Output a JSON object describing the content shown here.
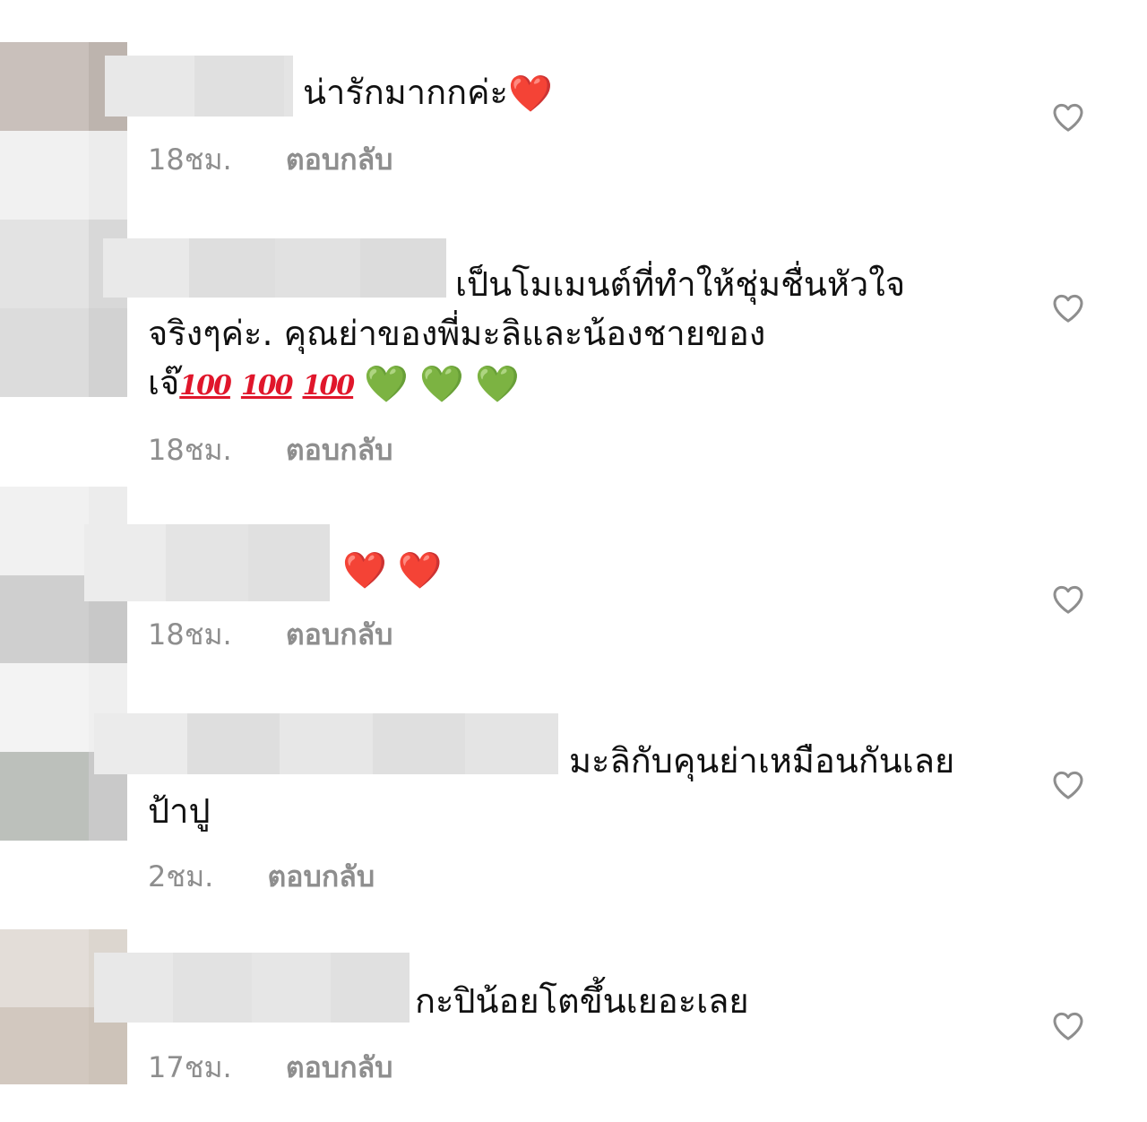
{
  "comments": [
    {
      "text": "น่ารักมากกค่ะ",
      "emoji": "❤️",
      "time": "18ชม.",
      "reply_label": "ตอบกลับ"
    },
    {
      "text_line1": "เป็นโมเมนต์ที่ทำให้ชุ่มชื่นหัวใจ",
      "text_line2": "จริงๆค่ะ. คุณย่าของพี่มะลิและน้องชายของ",
      "text_line3": "เจ๊",
      "hundred": "100",
      "green_heart": "💚",
      "time": "18ชม.",
      "reply_label": "ตอบกลับ"
    },
    {
      "emoji": "❤️",
      "time": "18ชม.",
      "reply_label": "ตอบกลับ"
    },
    {
      "text_line1": "มะลิกับคุนย่าเหมือนกันเลย",
      "text_line2": "ป้าปู",
      "time": "2ชม.",
      "reply_label": "ตอบกลับ"
    },
    {
      "text": "กะปิน้อยโตขึ้นเยอะเลย",
      "time": "17ชม.",
      "reply_label": "ตอบกลับ"
    }
  ],
  "icons": {
    "like": "heart-outline-icon"
  },
  "colors": {
    "text": "#111111",
    "meta": "#8e8e8e",
    "like_icon": "#8e8e8e",
    "red_heart": "#e0162b",
    "green_heart": "#3fbf2f",
    "hundred": "#e0162b"
  }
}
